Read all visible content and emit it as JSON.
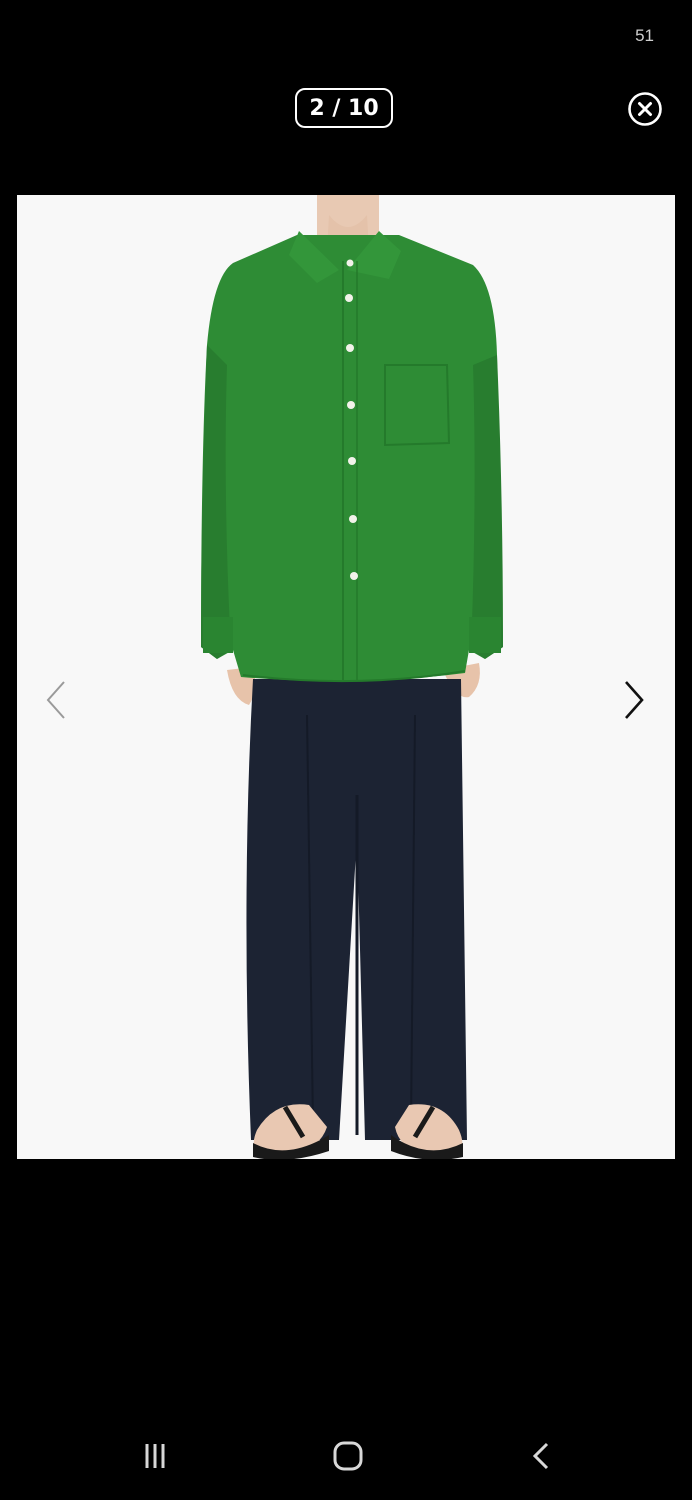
{
  "status_bar": {
    "time": "51"
  },
  "viewer": {
    "counter": "2 / 10",
    "close_icon": "close-circle-icon",
    "prev_icon": "chevron-left-icon",
    "next_icon": "chevron-right-icon",
    "image_subject": "product-photo-green-shirt-navy-trousers"
  },
  "colors": {
    "background": "#000000",
    "photo_background": "#f8f8f8",
    "shirt_green": "#2e8c35",
    "trousers_navy": "#1c2333"
  },
  "navbar": {
    "recents_icon": "recents-icon",
    "home_icon": "home-icon",
    "back_icon": "back-icon"
  }
}
